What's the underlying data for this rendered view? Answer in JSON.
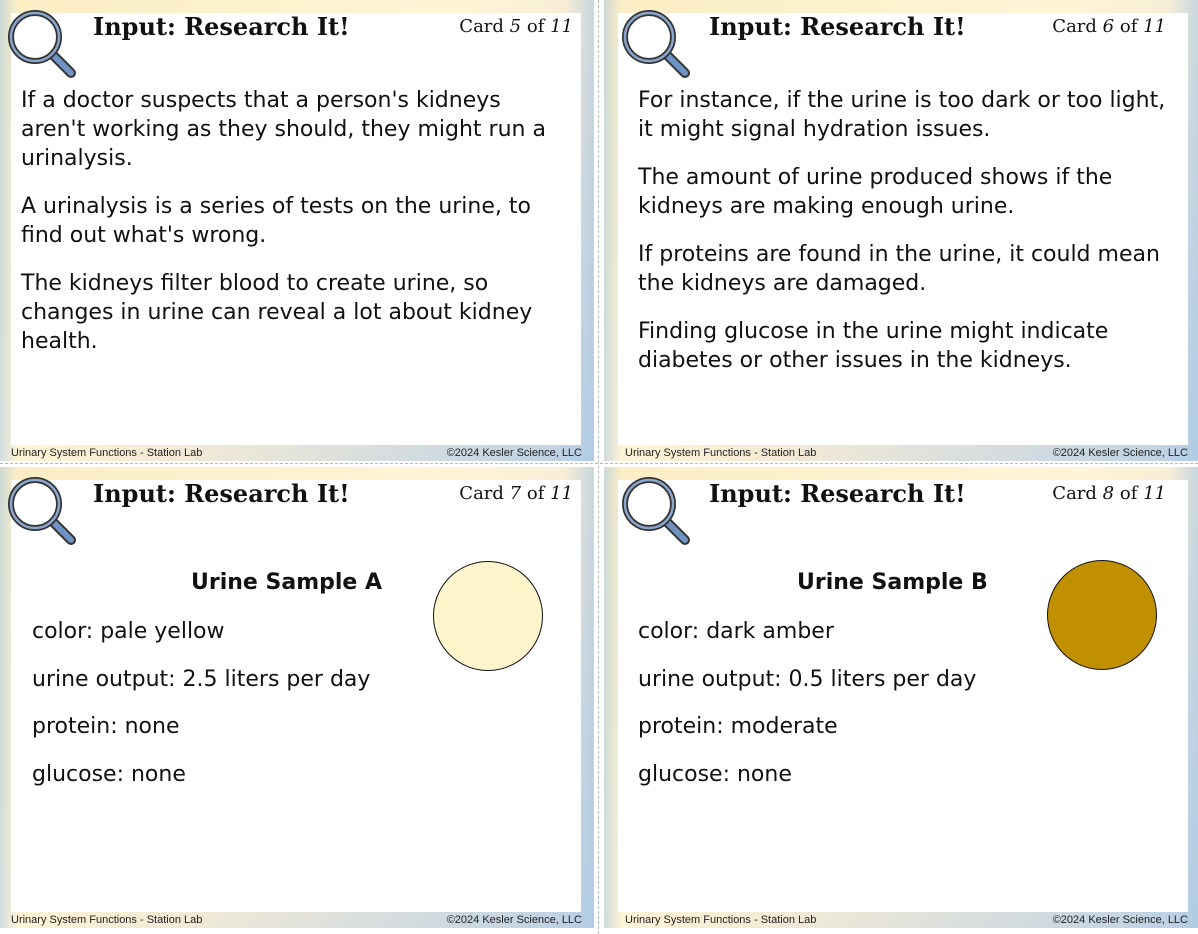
{
  "cards": [
    {
      "title": "Input: Research It!",
      "card_word": "Card",
      "card_num": "5",
      "of_word": "of",
      "card_total": "11",
      "paragraphs": [
        "If a doctor suspects that a person's kidneys aren't working as they should, they might run a urinalysis.",
        "A urinalysis is a series of tests on the urine, to find out what's wrong.",
        "The kidneys filter blood to create urine, so changes in urine can reveal a lot about kidney health."
      ],
      "footer_left": "Urinary System Functions - Station Lab",
      "footer_right": "©2024 Kesler Science, LLC"
    },
    {
      "title": "Input: Research It!",
      "card_word": "Card",
      "card_num": "6",
      "of_word": "of",
      "card_total": "11",
      "paragraphs": [
        "For instance, if the urine is too dark or too light, it might signal hydration issues.",
        "The amount of urine produced shows if the kidneys are making enough urine.",
        "If proteins are found in the urine, it could mean the kidneys are damaged.",
        "Finding glucose in the urine might indicate diabetes or other issues in the kidneys."
      ],
      "footer_left": "Urinary System Functions - Station Lab",
      "footer_right": "©2024 Kesler Science, LLC"
    },
    {
      "title": "Input: Research It!",
      "card_word": "Card",
      "card_num": "7",
      "of_word": "of",
      "card_total": "11",
      "sample_title": "Urine Sample A",
      "sample_color_hex": "#fff4cc",
      "lines": [
        "color: pale yellow",
        "urine output: 2.5 liters per day",
        "protein: none",
        "glucose: none"
      ],
      "footer_left": "Urinary System Functions - Station Lab",
      "footer_right": "©2024 Kesler Science, LLC"
    },
    {
      "title": "Input: Research It!",
      "card_word": "Card",
      "card_num": "8",
      "of_word": "of",
      "card_total": "11",
      "sample_title": "Urine Sample B",
      "sample_color_hex": "#c09000",
      "lines": [
        "color: dark amber",
        "urine output: 0.5 liters per day",
        "protein: moderate",
        "glucose: none"
      ],
      "footer_left": "Urinary System Functions - Station Lab",
      "footer_right": "©2024 Kesler Science, LLC"
    }
  ],
  "icons": {
    "header": "magnifying-glass-icon"
  },
  "colors": {
    "icon_stroke": "#333333",
    "icon_fill": "#6f93c4",
    "border_blue": "#b9d0e6",
    "border_yellow": "#fbeec4"
  }
}
